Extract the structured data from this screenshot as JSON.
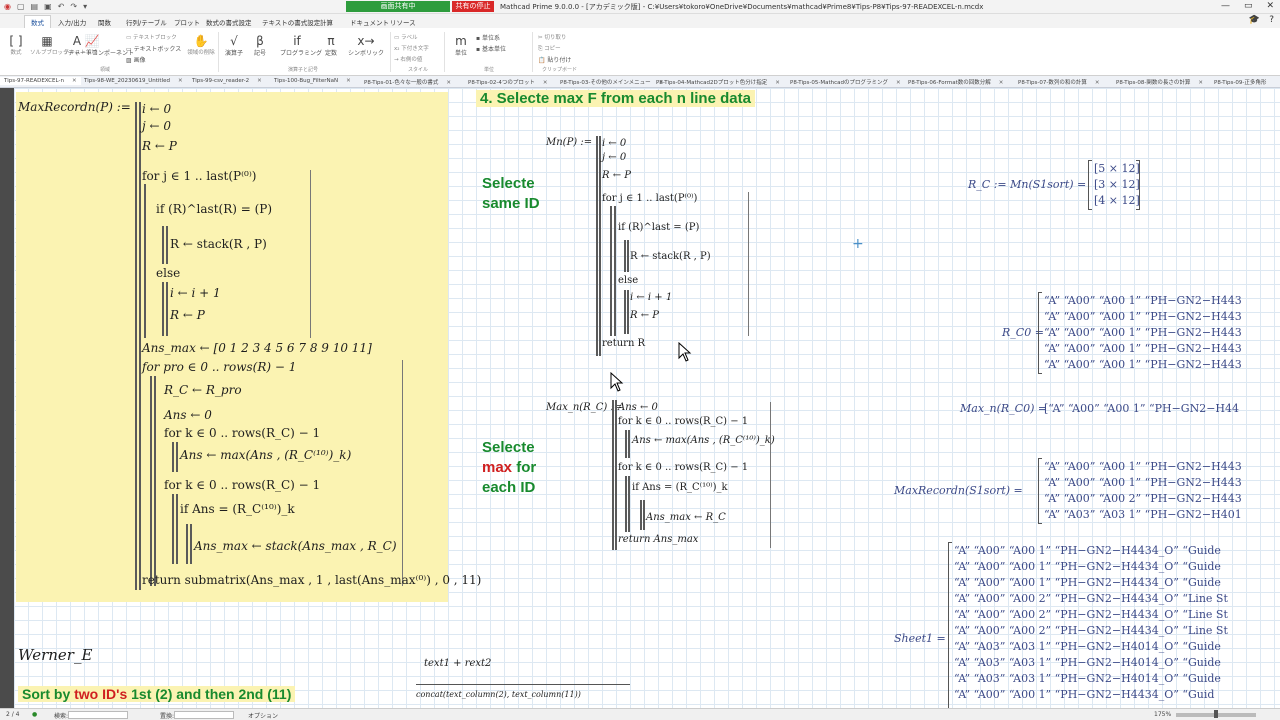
{
  "titlebar": {
    "share_label": "画面共有中",
    "stop_label": "共有の停止",
    "title": "Mathcad Prime 9.0.0.0 - [アカデミック版] - C:¥Users¥tokoro¥OneDrive¥Documents¥mathcad¥Prime8¥Tips-P8¥Tips-97-READEXCEL-n.mcdx"
  },
  "menu_tabs": [
    "数式",
    "入力/出力",
    "関数",
    "行列/テーブル",
    "プロット",
    "数式の書式設定",
    "テキストの書式設定",
    "計算",
    "ドキュメント",
    "リソース"
  ],
  "ribbon": {
    "buttons": [
      {
        "label": "数式",
        "icon": "math-icon"
      },
      {
        "label": "ソルブブロック",
        "icon": "solve-block-icon"
      },
      {
        "label": "テキスト領域",
        "icon": "text-region-icon"
      },
      {
        "label": "チャートコンポーネント",
        "icon": "chart-icon"
      },
      {
        "label": "テキストブロック",
        "icon": "text-block-icon"
      },
      {
        "label": "テキストボックス",
        "icon": "text-box-icon"
      },
      {
        "label": "画像",
        "icon": "image-icon"
      },
      {
        "label": "領域の削除",
        "icon": "delete-region-icon"
      },
      {
        "label": "演算子",
        "icon": "operator-icon"
      },
      {
        "label": "記号",
        "icon": "symbol-icon"
      },
      {
        "label": "プログラミング",
        "icon": "programming-icon"
      },
      {
        "label": "定数",
        "icon": "constant-icon"
      },
      {
        "label": "シンボリック",
        "icon": "symbolic-icon"
      },
      {
        "label": "ラベル",
        "icon": "label-icon"
      },
      {
        "label": "下付き文字",
        "icon": "subscript-icon"
      },
      {
        "label": "右側の値",
        "icon": "right-value-icon"
      },
      {
        "label": "単位",
        "icon": "unit-icon"
      },
      {
        "label": "単位系",
        "icon": "unit-system-icon"
      },
      {
        "label": "基本単位",
        "icon": "base-unit-icon"
      },
      {
        "label": "切り取り",
        "icon": "cut-icon"
      },
      {
        "label": "コピー",
        "icon": "copy-icon"
      },
      {
        "label": "貼り付け",
        "icon": "paste-icon"
      }
    ],
    "groups": [
      "領域",
      "演算子と記号",
      "スタイル",
      "単位",
      "クリップボード"
    ]
  },
  "doc_tabs": [
    "Tips-97-READEXCEL-n",
    "Tips-98-WE_20230619_Untitled",
    "Tips-99-csv_reader-2",
    "Tips-100-Bug_FilterNaN",
    "P8-Tips-01-色々な一般の書式",
    "P8-Tips-02-4つのプロット",
    "P8-Tips-03-その他のメインメニュー",
    "P8-Tips-04-Mathcad2Dプロット色分け指定",
    "P8-Tips-05-Mathcadのプログラミング",
    "P8-Tips-06-Format数の回数分解",
    "P8-Tips-07-数列の和の計算",
    "P8-Tips-08-関数の長さの計算",
    "P8-Tips-09-正多角形"
  ],
  "worksheet": {
    "heading4": "4. Selecte max F from each n line data",
    "label_same_id": [
      "Selecte",
      "same ID"
    ],
    "label_max": {
      "line1": "Selecte",
      "red": "max",
      "rest": " for",
      "line3": "each ID"
    },
    "author": "Werner_E",
    "sort_text": {
      "pre": "Sort by ",
      "red": "two ID's",
      "post": " 1st (2) and then 2nd (11)"
    },
    "text_expr": "text1 + rext2",
    "concat_expr": "concat(text_column(2), text_column(11))",
    "maxrecord": {
      "lhs": "MaxRecordn(P) :=",
      "lines": [
        "i ← 0",
        "j ← 0",
        "R ← P",
        "for j ∈ 1 .. last(P⁽⁰⁾)",
        "if (R)^last(R) = (P)",
        "R ← stack(R , P)",
        "else",
        "i ← i + 1",
        "R ← P",
        "Ans_max ← [0  1  2  3  4  5  6  7  8  9  10  11]",
        "for pro ∈ 0 .. rows(R) − 1",
        "R_C ← R_pro",
        "Ans ← 0",
        "for k ∈ 0 .. rows(R_C) − 1",
        "Ans ← max(Ans , (R_C⁽¹⁰⁾)_k)",
        "for k ∈ 0 .. rows(R_C) − 1",
        "if Ans = (R_C⁽¹⁰⁾)_k",
        "Ans_max ← stack(Ans_max , R_C)",
        "return submatrix(Ans_max , 1 , last(Ans_max⁽⁰⁾) , 0 , 11)"
      ]
    },
    "mn": {
      "lhs": "Mn(P) :=",
      "lines": [
        "i ← 0",
        "j ← 0",
        "R ← P",
        "for j ∈ 1 .. last(P⁽⁰⁾)",
        "if (R)^last = (P)",
        "R ← stack(R , P)",
        "else",
        "i ← i + 1",
        "R ← P",
        "return R"
      ]
    },
    "maxn": {
      "lhs": "Max_n(R_C) :=",
      "lines": [
        "Ans ← 0",
        "for k ∈ 0 .. rows(R_C) − 1",
        "Ans ← max(Ans , (R_C⁽¹⁰⁾)_k)",
        "for k ∈ 0 .. rows(R_C) − 1",
        "if Ans = (R_C⁽¹⁰⁾)_k",
        "Ans_max ← R_C",
        "return Ans_max"
      ]
    },
    "rc_def": {
      "lhs": "R_C := Mn(S1sort) =",
      "values": [
        "[5 × 12]",
        "[3 × 12]",
        "[4 × 12]"
      ]
    },
    "rc0": {
      "lhs": "R_C0 =",
      "rows": [
        "“A”  “A00”  “A00 1”  “PH−GN2−H443",
        "“A”  “A00”  “A00 1”  “PH−GN2−H443",
        "“A”  “A00”  “A00 1”  “PH−GN2−H443",
        "“A”  “A00”  “A00 1”  “PH−GN2−H443",
        "“A”  “A00”  “A00 1”  “PH−GN2−H443"
      ]
    },
    "maxn_rc0": {
      "lhs": "Max_n(R_C0) =",
      "row": "[“A”  “A00”  “A00 1”  “PH−GN2−H44"
    },
    "maxrec_s1": {
      "lhs": "MaxRecordn(S1sort) =",
      "rows": [
        "“A”  “A00”  “A00 1”  “PH−GN2−H443",
        "“A”  “A00”  “A00 1”  “PH−GN2−H443",
        "“A”  “A00”  “A00 2”  “PH−GN2−H443",
        "“A”  “A03”  “A03 1”  “PH−GN2−H401"
      ]
    },
    "sheet1": {
      "lhs": "Sheet1 =",
      "rows": [
        "“A”  “A00”  “A00 1”  “PH−GN2−H4434_O”  “Guide",
        "“A”  “A00”  “A00 1”  “PH−GN2−H4434_O”  “Guide",
        "“A”  “A00”  “A00 1”  “PH−GN2−H4434_O”  “Guide",
        "“A”  “A00”  “A00 2”  “PH−GN2−H4434_O”  “Line St",
        "“A”  “A00”  “A00 2”  “PH−GN2−H4434_O”  “Line St",
        "“A”  “A00”  “A00 2”  “PH−GN2−H4434_O”  “Line St",
        "“A”  “A03”  “A03 1”  “PH−GN2−H4014_O”  “Guide",
        "“A”  “A03”  “A03 1”  “PH−GN2−H4014_O”  “Guide",
        "“A”  “A03”  “A03 1”  “PH−GN2−H4014_O”  “Guide",
        "“A”  “A00”  “A00 1”  “PH−GN2−H4434_O”  “Guid"
      ]
    }
  },
  "statusbar": {
    "page": "2 / 4",
    "search": "検索:",
    "replace": "置換:",
    "options": "オプション",
    "zoom": "175%"
  },
  "colors": {
    "heading_green": "#188a2e",
    "highlight_yellow": "#fbf3b2",
    "result_blue": "#3c4a88",
    "accent_red": "#d02020"
  }
}
